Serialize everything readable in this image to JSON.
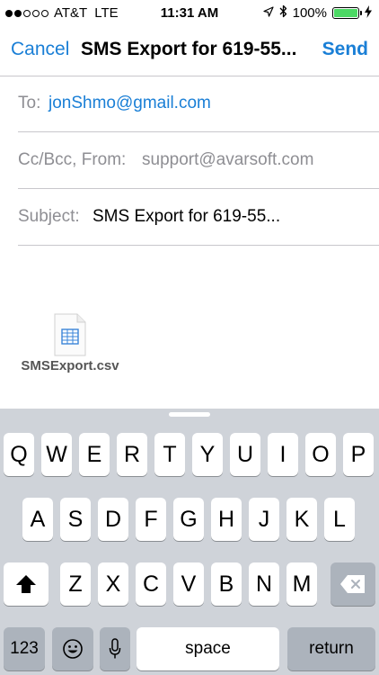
{
  "status_bar": {
    "carrier": "AT&T",
    "network": "LTE",
    "time": "11:31 AM",
    "battery": "100%",
    "signal_bars_filled": 2,
    "signal_bars_total": 5,
    "battery_level": 1.0,
    "battery_color": "#4cd964"
  },
  "nav": {
    "cancel": "Cancel",
    "title": "SMS Export for 619-55...",
    "send": "Send"
  },
  "fields": {
    "to_label": "To:",
    "to_value": "jonShmo@gmail.com",
    "cc_label": "Cc/Bcc, From:",
    "cc_value": "support@avarsoft.com",
    "subject_label": "Subject:",
    "subject_value": "SMS Export for 619-55..."
  },
  "attachment": {
    "filename": "SMSExport.csv",
    "icon": "spreadsheet-file-icon"
  },
  "keyboard": {
    "row1": [
      "Q",
      "W",
      "E",
      "R",
      "T",
      "Y",
      "U",
      "I",
      "O",
      "P"
    ],
    "row2": [
      "A",
      "S",
      "D",
      "F",
      "G",
      "H",
      "J",
      "K",
      "L"
    ],
    "row3": [
      "Z",
      "X",
      "C",
      "V",
      "B",
      "N",
      "M"
    ],
    "numbers": "123",
    "space": "space",
    "return": "return",
    "icons": [
      "shift-icon",
      "backspace-icon",
      "emoji-icon",
      "microphone-icon"
    ]
  },
  "colors": {
    "accent": "#1a7fd6",
    "keyboard_bg": "#cfd3d9",
    "dark_key": "#acb3bc"
  }
}
